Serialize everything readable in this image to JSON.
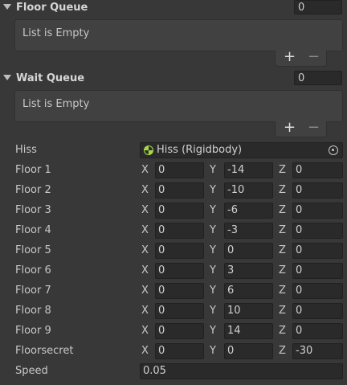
{
  "floor_queue": {
    "title": "Floor Queue",
    "count": "0",
    "empty_text": "List is Empty",
    "add_label": "+",
    "remove_label": "−"
  },
  "wait_queue": {
    "title": "Wait Queue",
    "count": "0",
    "empty_text": "List is Empty",
    "add_label": "+",
    "remove_label": "−"
  },
  "hiss": {
    "label": "Hiss",
    "value": "Hiss (Rigidbody)",
    "icon": "rigidbody-icon"
  },
  "axes": {
    "x": "X",
    "y": "Y",
    "z": "Z"
  },
  "floors": [
    {
      "label": "Floor 1",
      "x": "0",
      "y": "-14",
      "z": "0"
    },
    {
      "label": "Floor 2",
      "x": "0",
      "y": "-10",
      "z": "0"
    },
    {
      "label": "Floor 3",
      "x": "0",
      "y": "-6",
      "z": "0"
    },
    {
      "label": "Floor 4",
      "x": "0",
      "y": "-3",
      "z": "0"
    },
    {
      "label": "Floor 5",
      "x": "0",
      "y": "0",
      "z": "0"
    },
    {
      "label": "Floor 6",
      "x": "0",
      "y": "3",
      "z": "0"
    },
    {
      "label": "Floor 7",
      "x": "0",
      "y": "6",
      "z": "0"
    },
    {
      "label": "Floor 8",
      "x": "0",
      "y": "10",
      "z": "0"
    },
    {
      "label": "Floor 9",
      "x": "0",
      "y": "14",
      "z": "0"
    },
    {
      "label": "Floorsecret",
      "x": "0",
      "y": "0",
      "z": "-30"
    }
  ],
  "speed": {
    "label": "Speed",
    "value": "0.05"
  }
}
